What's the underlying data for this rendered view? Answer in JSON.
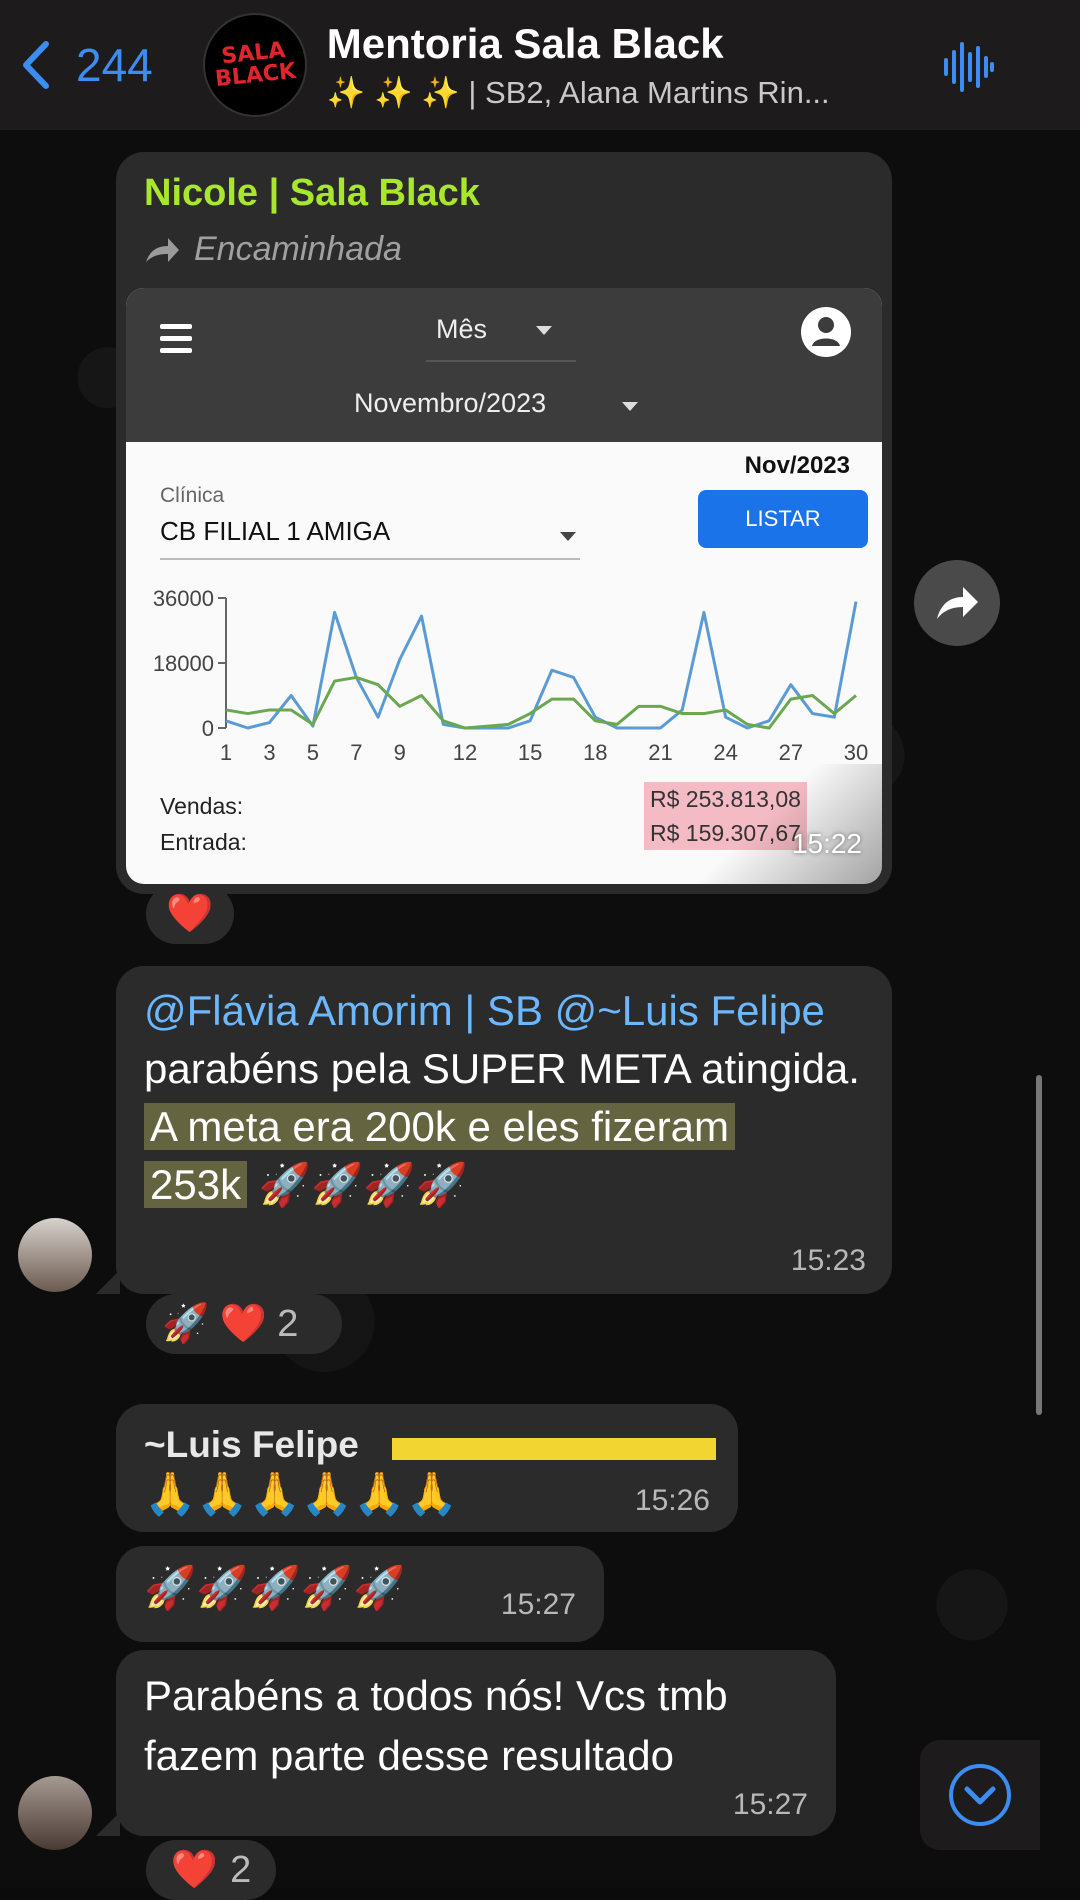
{
  "header": {
    "back_count": "244",
    "group_avatar_text": "SALA\nBLACK",
    "title": "Mentoria Sala Black",
    "subtitle": "✨ ✨ ✨ | SB2, Alana Martins Rin..."
  },
  "messages": {
    "forwarded": {
      "sender": "Nicole | Sala Black",
      "forwarded_label": "Encaminhada",
      "time": "15:22",
      "reaction": "❤️",
      "screenshot": {
        "period_select": "Mês",
        "month_select": "Novembro/2023",
        "period_label": "Nov/2023",
        "clinic_label": "Clínica",
        "clinic_value": "CB FILIAL 1 AMIGA",
        "list_button": "LISTAR",
        "sales_label": "Vendas:",
        "entry_label": "Entrada:",
        "sales_value": "R$ 253.813,08",
        "entry_value": "R$ 159.307,67"
      }
    },
    "congrats": {
      "mention1": "@Flávia Amorim | SB",
      "mention2": "@~Luis Felipe",
      "line1": "parabéns pela SUPER META atingida.",
      "highlight1": "A meta era 200k e eles fizeram",
      "highlight2": "253k",
      "emojis": "🚀🚀🚀🚀",
      "time": "15:23",
      "reactions": "🚀 ❤️",
      "reaction_count": "2"
    },
    "luis": {
      "sender": "~Luis Felipe",
      "emojis": "🙏🙏🙏🙏🙏🙏",
      "time": "15:26"
    },
    "rockets": {
      "emojis": "🚀🚀🚀🚀🚀",
      "time": "15:27"
    },
    "final": {
      "text": "Parabéns a todos nós! Vcs tmb fazem parte desse resultado",
      "time": "15:27",
      "reaction": "❤️",
      "reaction_count": "2"
    }
  },
  "chart_data": {
    "type": "line",
    "title": "",
    "xlabel": "",
    "ylabel": "",
    "x_ticks": [
      1,
      3,
      5,
      7,
      9,
      12,
      15,
      18,
      21,
      24,
      27,
      30
    ],
    "y_ticks": [
      0,
      18000,
      36000
    ],
    "ylim": [
      0,
      36000
    ],
    "xlim": [
      1,
      30
    ],
    "series": [
      {
        "color": "#5b9bd5",
        "x": [
          1,
          2,
          3,
          4,
          5,
          6,
          7,
          8,
          9,
          10,
          11,
          12,
          13,
          14,
          15,
          16,
          17,
          18,
          19,
          20,
          21,
          22,
          23,
          24,
          25,
          26,
          27,
          28,
          29,
          30
        ],
        "values": [
          2000,
          0,
          1500,
          9000,
          500,
          32000,
          14000,
          3000,
          19000,
          31000,
          1000,
          0,
          0,
          0,
          2000,
          16000,
          14000,
          3000,
          0,
          0,
          0,
          5000,
          32000,
          3000,
          0,
          2000,
          12000,
          4000,
          3000,
          35000
        ]
      },
      {
        "color": "#6aa84f",
        "x": [
          1,
          2,
          3,
          4,
          5,
          6,
          7,
          8,
          9,
          10,
          11,
          12,
          13,
          14,
          15,
          16,
          17,
          18,
          19,
          20,
          21,
          22,
          23,
          24,
          25,
          26,
          27,
          28,
          29,
          30
        ],
        "values": [
          5000,
          4000,
          5000,
          5000,
          1000,
          13000,
          14000,
          12000,
          6000,
          9000,
          2000,
          0,
          500,
          1000,
          4000,
          8000,
          8000,
          2000,
          1000,
          6000,
          6000,
          4000,
          4000,
          5000,
          1000,
          0,
          8000,
          9000,
          4000,
          9000
        ]
      }
    ]
  }
}
